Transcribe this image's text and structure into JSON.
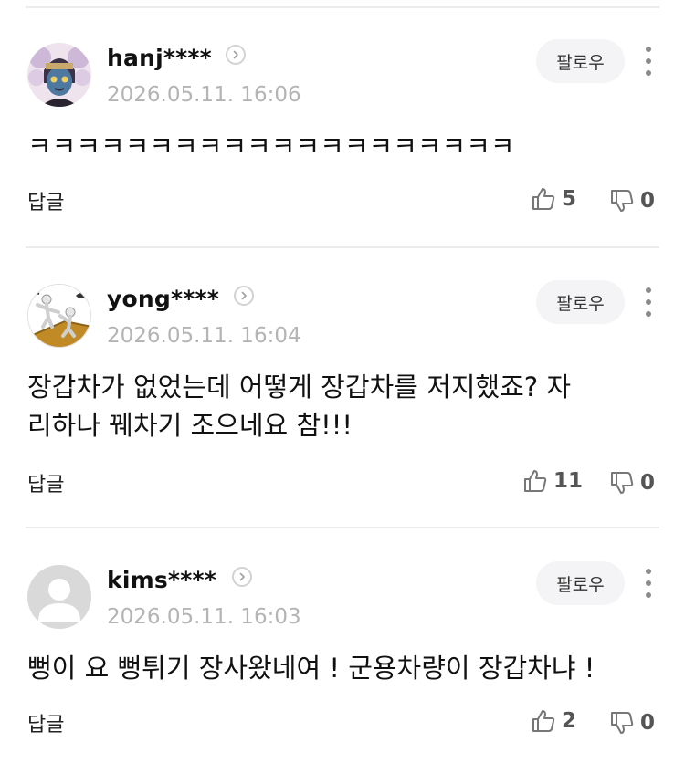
{
  "comments": [
    {
      "username": "hanj****",
      "timestamp": "2026.05.11. 16:06",
      "follow_label": "팔로우",
      "text": "ㅋㅋㅋㅋㅋㅋㅋㅋㅋㅋㅋㅋㅋㅋㅋㅋㅋㅋㅋㅋ",
      "reply_label": "답글",
      "likes": "5",
      "dislikes": "0",
      "avatar": "character-avatar-icon"
    },
    {
      "username": "yong****",
      "timestamp": "2026.05.11. 16:04",
      "follow_label": "팔로우",
      "text": "장갑차가 없었는데 어떻게 장갑차를 저지했죠? 자\n리하나 꿰차기 조으네요 참!!!",
      "reply_label": "답글",
      "likes": "11",
      "dislikes": "0",
      "avatar": "figures-avatar-icon"
    },
    {
      "username": "kims****",
      "timestamp": "2026.05.11. 16:03",
      "follow_label": "팔로우",
      "text": "뻥이 요 뻥튀기 장사왔네여 ! 군용차량이 장갑차냐 !",
      "reply_label": "답글",
      "likes": "2",
      "dislikes": "0",
      "avatar": "default-user-icon"
    }
  ],
  "icons": {
    "profile": "chevron-right-icon",
    "more": "more-vertical-icon",
    "like": "thumbs-up-icon",
    "dislike": "thumbs-down-icon"
  },
  "colors": {
    "divider": "#ececec",
    "timestamp": "#b4b4b4",
    "follow_bg": "#f4f4f6"
  }
}
